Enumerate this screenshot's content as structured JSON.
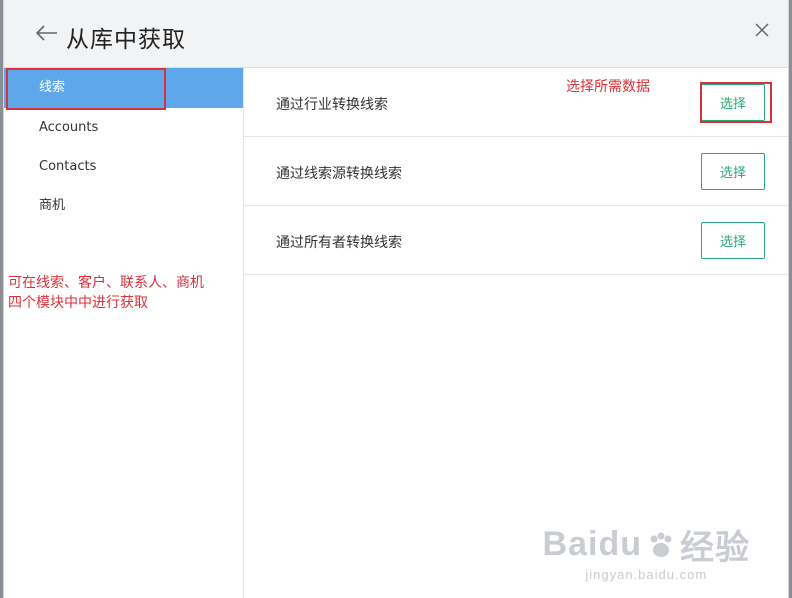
{
  "dialog": {
    "title": "从库中获取"
  },
  "sidebar": {
    "items": [
      {
        "label": "线索",
        "active": true
      },
      {
        "label": "Accounts",
        "active": false
      },
      {
        "label": "Contacts",
        "active": false
      },
      {
        "label": "商机",
        "active": false
      }
    ]
  },
  "main": {
    "rows": [
      {
        "label": "通过行业转换线索",
        "button": "选择"
      },
      {
        "label": "通过线索源转换线索",
        "button": "选择"
      },
      {
        "label": "通过所有者转换线索",
        "button": "选择"
      }
    ]
  },
  "annotations": {
    "select_needed_data": "选择所需数据",
    "modules_line1": "可在线索、客户、联系人、商机",
    "modules_line2": "四个模块中中进行获取"
  },
  "watermark": {
    "brand": "Baidu",
    "brand_suffix": "经验",
    "site": "jingyan.baidu.com"
  },
  "colors": {
    "accent_blue": "#5ea7ea",
    "button_green": "#2aa876",
    "annotation_red": "#d9313a"
  }
}
